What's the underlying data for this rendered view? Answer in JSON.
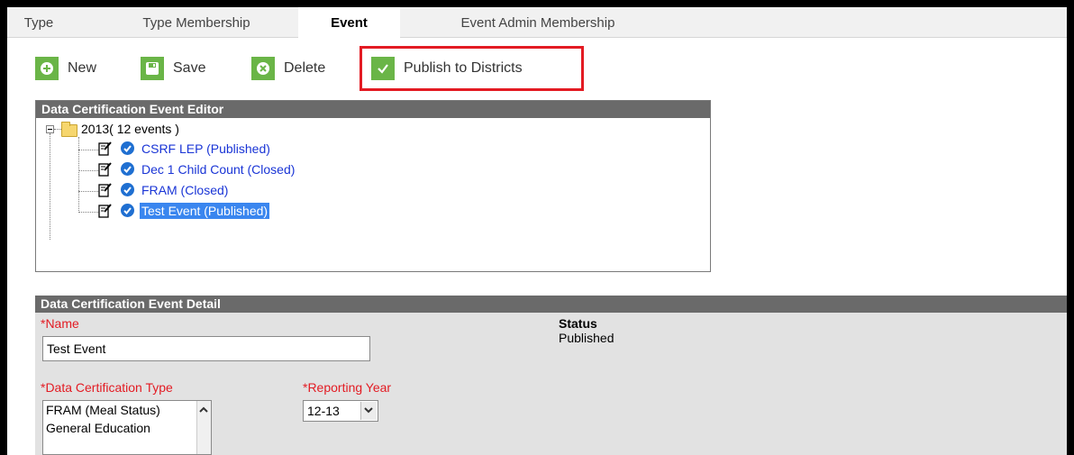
{
  "tabs": [
    {
      "label": "Type"
    },
    {
      "label": "Type Membership"
    },
    {
      "label": "Event"
    },
    {
      "label": "Event Admin Membership"
    }
  ],
  "toolbar": {
    "new_label": "New",
    "save_label": "Save",
    "delete_label": "Delete",
    "publish_label": "Publish to Districts"
  },
  "editor": {
    "title": "Data Certification Event Editor",
    "year_node": "2013( 12 events )",
    "events": [
      {
        "label": "CSRF LEP (Published)"
      },
      {
        "label": "Dec 1 Child Count (Closed)"
      },
      {
        "label": "FRAM (Closed)"
      },
      {
        "label": "Test Event (Published)"
      }
    ]
  },
  "detail": {
    "title": "Data Certification Event Detail",
    "name_label": "*Name",
    "name_value": "Test Event",
    "status_label": "Status",
    "status_value": "Published",
    "cert_type_label": "*Data Certification Type",
    "cert_type_options": [
      "FRAM (Meal Status)",
      "General Education"
    ],
    "reporting_year_label": "*Reporting Year",
    "reporting_year_value": "12-13"
  },
  "colors": {
    "accent_green": "#6ab547",
    "highlight_red": "#e31b23",
    "link_blue": "#1a35d6",
    "selection_blue": "#3a86ef"
  }
}
